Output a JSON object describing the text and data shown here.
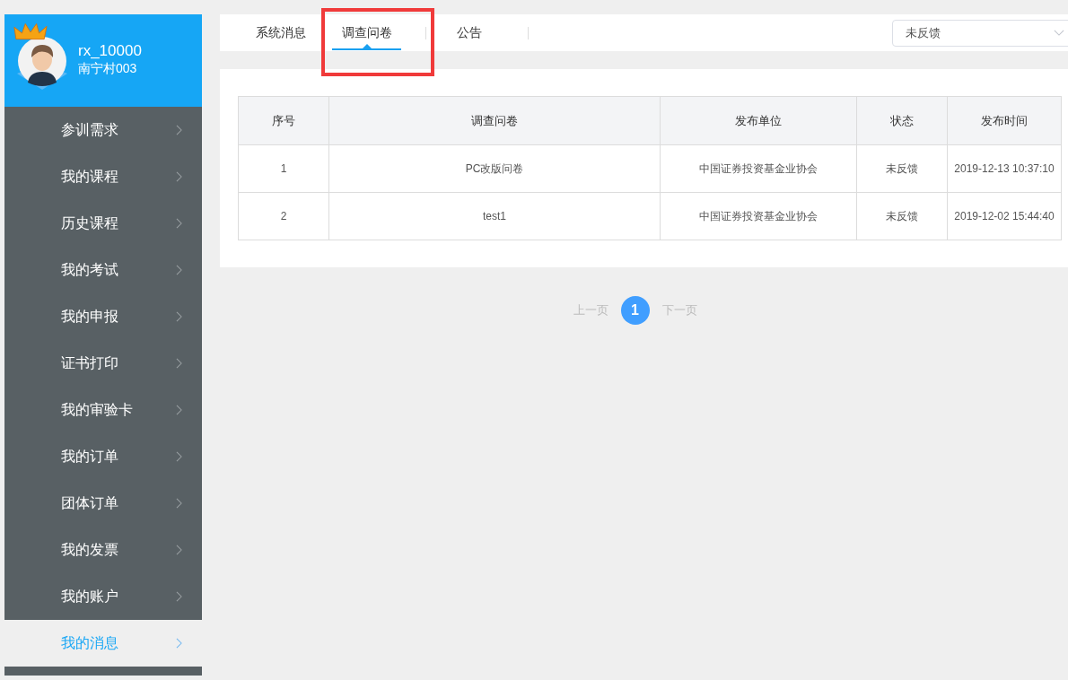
{
  "profile": {
    "username": "rx_10000",
    "organization": "南宁村003"
  },
  "sidebar": {
    "items": [
      {
        "label": "参训需求",
        "selected": false
      },
      {
        "label": "我的课程",
        "selected": false
      },
      {
        "label": "历史课程",
        "selected": false
      },
      {
        "label": "我的考试",
        "selected": false
      },
      {
        "label": "我的申报",
        "selected": false
      },
      {
        "label": "证书打印",
        "selected": false
      },
      {
        "label": "我的审验卡",
        "selected": false
      },
      {
        "label": "我的订单",
        "selected": false
      },
      {
        "label": "团体订单",
        "selected": false
      },
      {
        "label": "我的发票",
        "selected": false
      },
      {
        "label": "我的账户",
        "selected": false
      },
      {
        "label": "我的消息",
        "selected": true
      }
    ]
  },
  "tabs": [
    {
      "label": "系统消息",
      "selected": false
    },
    {
      "label": "调查问卷",
      "selected": true
    },
    {
      "label": "公告",
      "selected": false
    }
  ],
  "filter": {
    "value": "未反馈"
  },
  "table": {
    "columns": [
      "序号",
      "调查问卷",
      "发布单位",
      "状态",
      "发布时间"
    ],
    "rows": [
      [
        "1",
        "PC改版问卷",
        "中国证券投资基金业协会",
        "未反馈",
        "2019-12-13 10:37:10"
      ],
      [
        "2",
        "test1",
        "中国证券投资基金业协会",
        "未反馈",
        "2019-12-02 15:44:40"
      ]
    ]
  },
  "pagination": {
    "prev": "上一页",
    "pages": [
      {
        "label": "1",
        "selected": true
      }
    ],
    "next": "下一页"
  }
}
